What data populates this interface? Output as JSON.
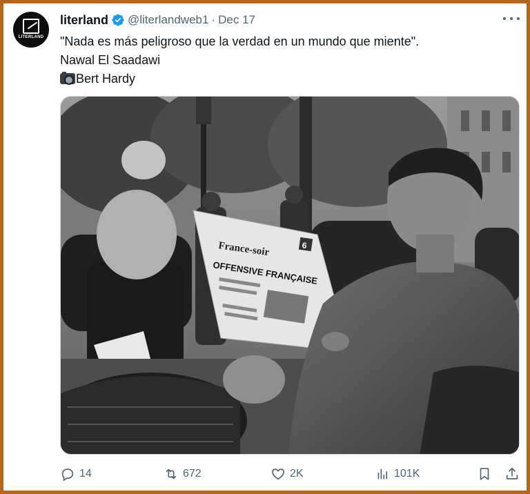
{
  "author": {
    "display_name": "literland",
    "handle": "@literlandweb1",
    "separator": "·",
    "date": "Dec 17",
    "avatar_text": "LITERLAND"
  },
  "tweet": {
    "line1": "\"Nada es más peligroso que la verdad en un mundo que miente\".",
    "line2": "Nawal El Saadawi",
    "line3": "Bert Hardy"
  },
  "photo": {
    "newspaper_masthead": "France-soir",
    "newspaper_headline": "OFFENSIVE FRANÇAISE",
    "newspaper_badge": "6"
  },
  "actions": {
    "replies": "14",
    "reposts": "672",
    "likes": "2K",
    "views": "101K"
  },
  "colors": {
    "border": "#b5651d",
    "muted": "#536471",
    "verified": "#1d9bf0"
  }
}
